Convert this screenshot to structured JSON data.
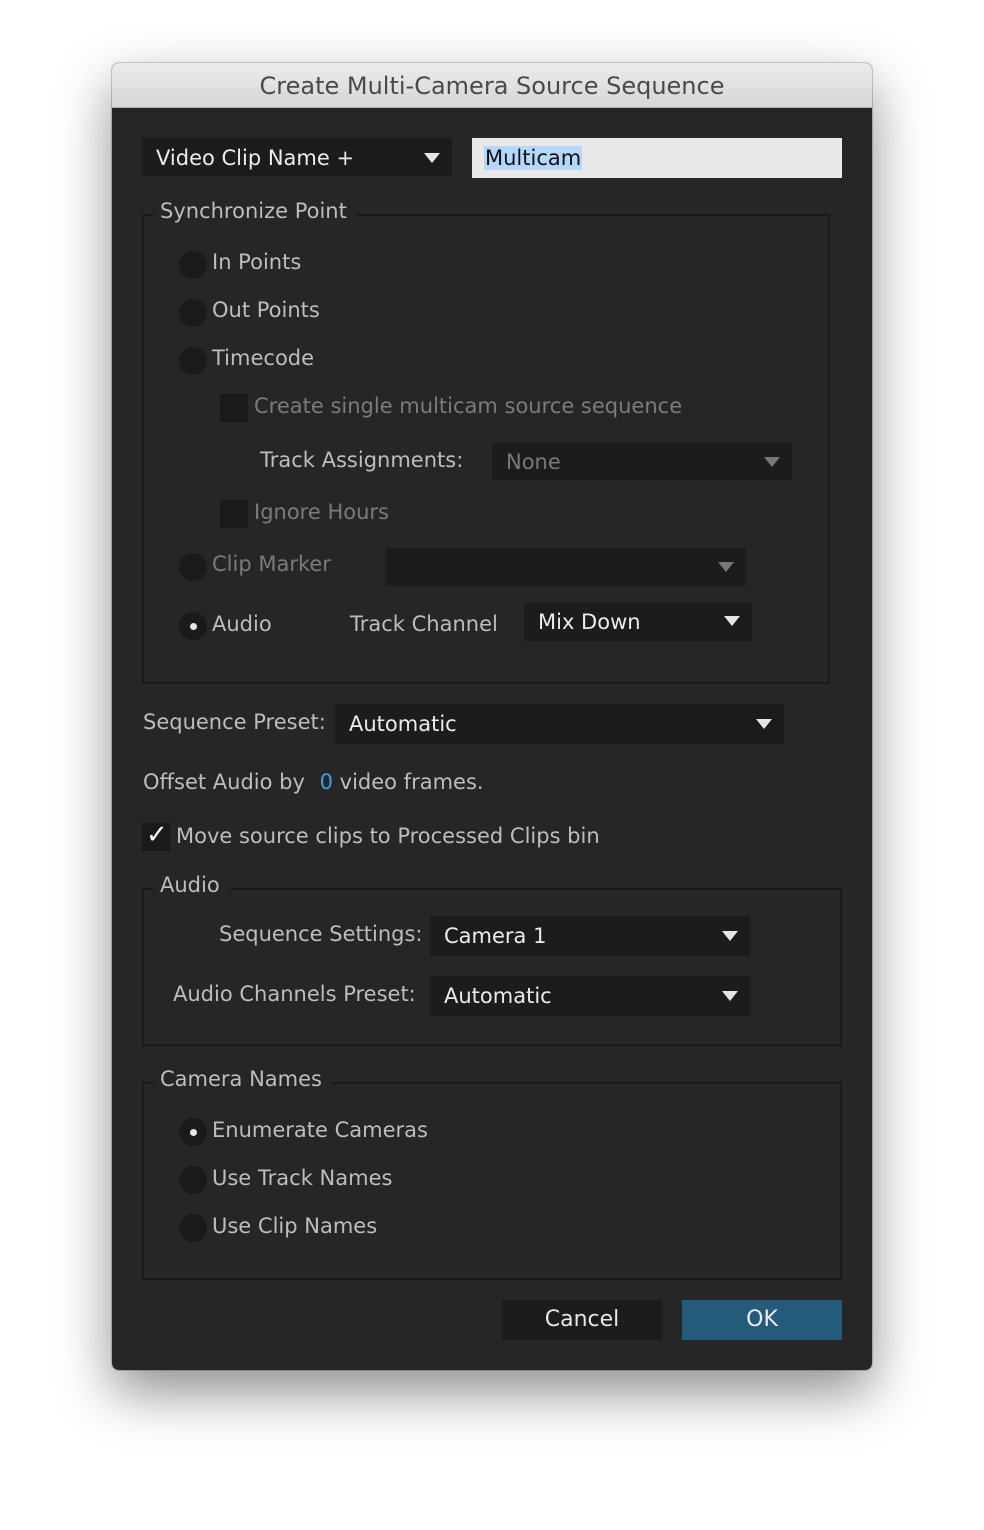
{
  "window": {
    "title": "Create Multi-Camera Source Sequence"
  },
  "naming": {
    "name_mode": "Video Clip Name +",
    "name_value": "Multicam"
  },
  "sync_point": {
    "legend": "Synchronize Point",
    "options": [
      {
        "label": "In Points",
        "selected": false,
        "enabled": true
      },
      {
        "label": "Out Points",
        "selected": false,
        "enabled": true
      },
      {
        "label": "Timecode",
        "selected": false,
        "enabled": true
      },
      {
        "label": "Clip Marker",
        "selected": false,
        "enabled": false
      },
      {
        "label": "Audio",
        "selected": true,
        "enabled": true
      }
    ],
    "create_single_label": "Create single multicam source sequence",
    "create_single_checked": false,
    "track_assignments_label": "Track Assignments:",
    "track_assignments_value": "None",
    "ignore_hours_label": "Ignore Hours",
    "ignore_hours_checked": false,
    "clip_marker_value": "",
    "track_channel_label": "Track Channel",
    "track_channel_value": "Mix Down"
  },
  "sequence_preset": {
    "label": "Sequence Preset:",
    "value": "Automatic"
  },
  "offset_audio": {
    "prefix": "Offset Audio by",
    "value": "0",
    "suffix": "video frames."
  },
  "move_clips": {
    "label": "Move source clips to Processed Clips bin",
    "checked": true
  },
  "audio_group": {
    "legend": "Audio",
    "sequence_settings_label": "Sequence Settings:",
    "sequence_settings_value": "Camera 1",
    "channels_preset_label": "Audio Channels Preset:",
    "channels_preset_value": "Automatic"
  },
  "camera_names": {
    "legend": "Camera Names",
    "options": [
      {
        "label": "Enumerate Cameras",
        "selected": true
      },
      {
        "label": "Use Track Names",
        "selected": false
      },
      {
        "label": "Use Clip Names",
        "selected": false
      }
    ]
  },
  "buttons": {
    "cancel": "Cancel",
    "ok": "OK"
  },
  "colors": {
    "accent": "#245a7a",
    "link_value": "#3ba3db",
    "background": "#262626"
  }
}
